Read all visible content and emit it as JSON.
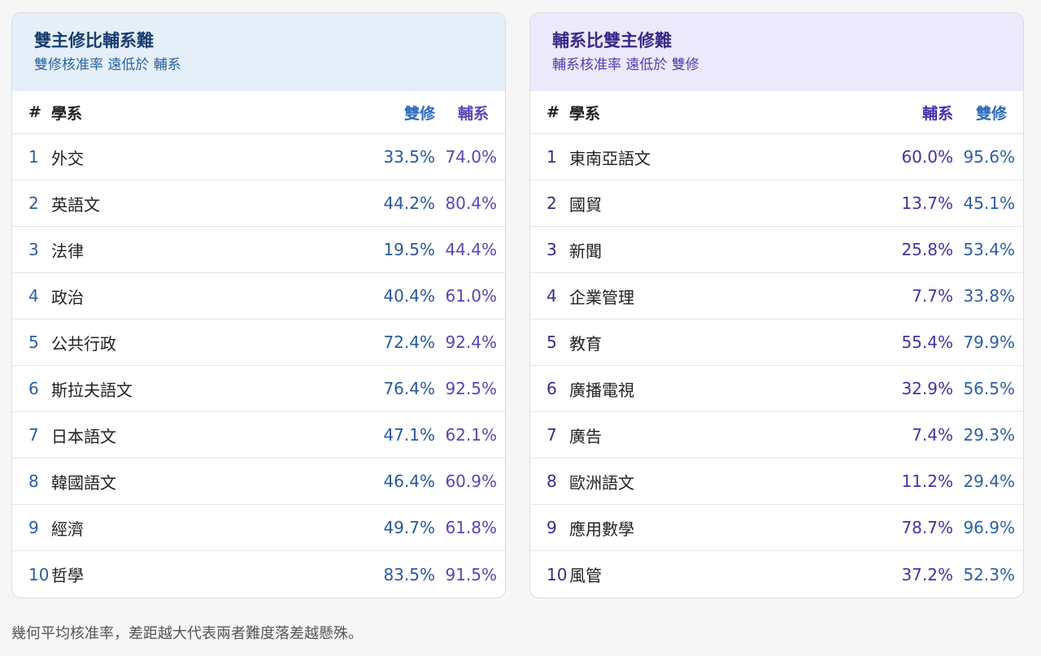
{
  "left": {
    "title": "雙主修比輔系難",
    "subtitle": "雙修核准率 遠低於 輔系",
    "columns": {
      "num": "#",
      "name": "學系",
      "v1": "雙修",
      "v2": "輔系"
    },
    "rows": [
      {
        "num": "1",
        "name": "外交",
        "v1": "33.5%",
        "v2": "74.0%"
      },
      {
        "num": "2",
        "name": "英語文",
        "v1": "44.2%",
        "v2": "80.4%"
      },
      {
        "num": "3",
        "name": "法律",
        "v1": "19.5%",
        "v2": "44.4%"
      },
      {
        "num": "4",
        "name": "政治",
        "v1": "40.4%",
        "v2": "61.0%"
      },
      {
        "num": "5",
        "name": "公共行政",
        "v1": "72.4%",
        "v2": "92.4%"
      },
      {
        "num": "6",
        "name": "斯拉夫語文",
        "v1": "76.4%",
        "v2": "92.5%"
      },
      {
        "num": "7",
        "name": "日本語文",
        "v1": "47.1%",
        "v2": "62.1%"
      },
      {
        "num": "8",
        "name": "韓國語文",
        "v1": "46.4%",
        "v2": "60.9%"
      },
      {
        "num": "9",
        "name": "經濟",
        "v1": "49.7%",
        "v2": "61.8%"
      },
      {
        "num": "10",
        "name": "哲學",
        "v1": "83.5%",
        "v2": "91.5%"
      }
    ]
  },
  "right": {
    "title": "輔系比雙主修難",
    "subtitle": "輔系核准率 遠低於 雙修",
    "columns": {
      "num": "#",
      "name": "學系",
      "v1": "輔系",
      "v2": "雙修"
    },
    "rows": [
      {
        "num": "1",
        "name": "東南亞語文",
        "v1": "60.0%",
        "v2": "95.6%"
      },
      {
        "num": "2",
        "name": "國貿",
        "v1": "13.7%",
        "v2": "45.1%"
      },
      {
        "num": "3",
        "name": "新聞",
        "v1": "25.8%",
        "v2": "53.4%"
      },
      {
        "num": "4",
        "name": "企業管理",
        "v1": "7.7%",
        "v2": "33.8%"
      },
      {
        "num": "5",
        "name": "教育",
        "v1": "55.4%",
        "v2": "79.9%"
      },
      {
        "num": "6",
        "name": "廣播電視",
        "v1": "32.9%",
        "v2": "56.5%"
      },
      {
        "num": "7",
        "name": "廣告",
        "v1": "7.4%",
        "v2": "29.3%"
      },
      {
        "num": "8",
        "name": "歐洲語文",
        "v1": "11.2%",
        "v2": "29.4%"
      },
      {
        "num": "9",
        "name": "應用數學",
        "v1": "78.7%",
        "v2": "96.9%"
      },
      {
        "num": "10",
        "name": "風管",
        "v1": "37.2%",
        "v2": "52.3%"
      }
    ]
  },
  "footnote": "幾何平均核准率，差距越大代表兩者難度落差越懸殊。"
}
